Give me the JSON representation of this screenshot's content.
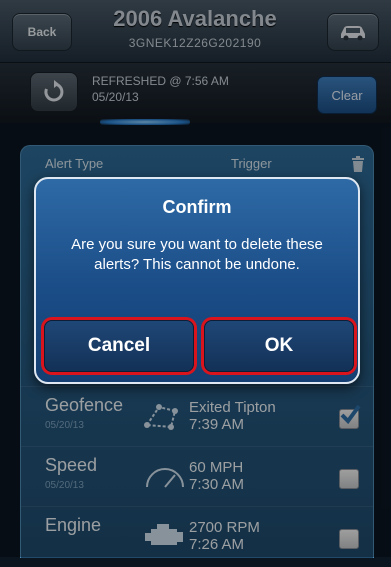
{
  "header": {
    "back_label": "Back",
    "title": "2006 Avalanche",
    "vin": "3GNEK12Z26G202190",
    "vehicle_icon": "car-icon"
  },
  "refresh": {
    "icon": "refresh-icon",
    "status_line1": "REFRESHED @ 7:56 AM",
    "status_line2": "05/20/13",
    "clear_label": "Clear"
  },
  "table": {
    "col_alert_type": "Alert Type",
    "col_trigger": "Trigger",
    "delete_icon": "trash-icon",
    "rows": [
      {
        "type": "Geofence",
        "date": "05/20/13",
        "icon": "geofence-icon",
        "trigger_line1": "Exited Tipton",
        "trigger_line2": "7:39 AM",
        "checked": true
      },
      {
        "type": "Speed",
        "date": "05/20/13",
        "icon": "speedometer-icon",
        "trigger_line1": "60 MPH",
        "trigger_line2": "7:30 AM",
        "checked": false
      },
      {
        "type": "Engine",
        "date": "",
        "icon": "engine-icon",
        "trigger_line1": "2700 RPM",
        "trigger_line2": "7:26 AM",
        "checked": false
      }
    ]
  },
  "dialog": {
    "title": "Confirm",
    "message": "Are you sure you want to delete these alerts? This cannot be undone.",
    "cancel_label": "Cancel",
    "ok_label": "OK",
    "highlight_color": "#d9141d"
  }
}
